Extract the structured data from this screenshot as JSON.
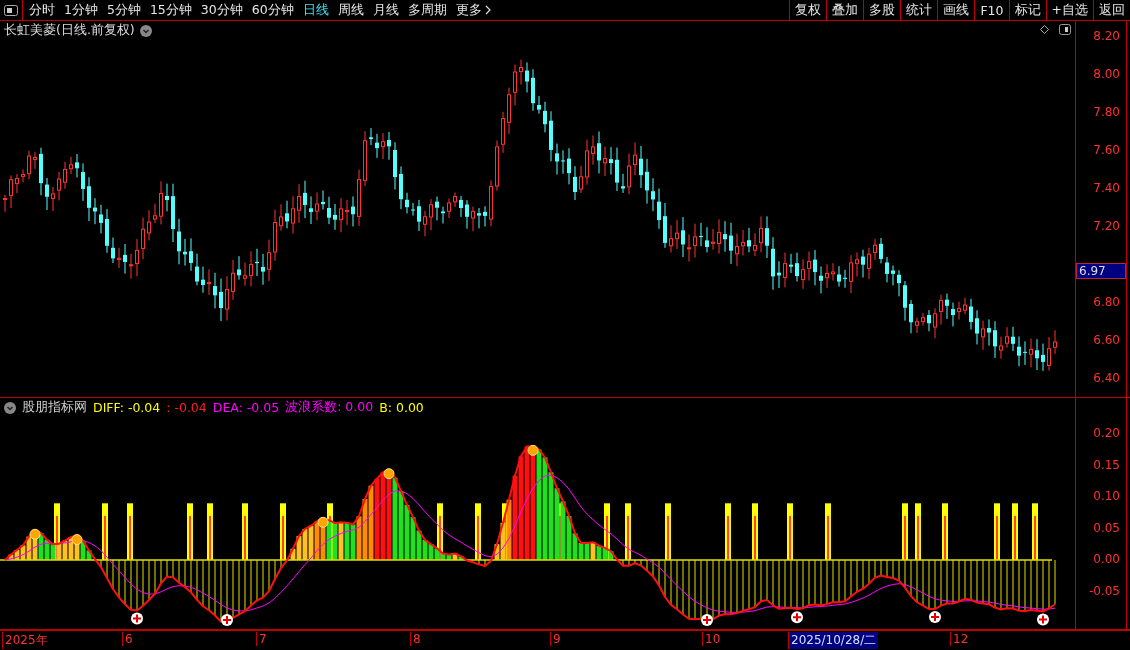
{
  "toolbar": {
    "periods": [
      {
        "label": "分时",
        "selected": false
      },
      {
        "label": "1分钟",
        "selected": false
      },
      {
        "label": "5分钟",
        "selected": false
      },
      {
        "label": "15分钟",
        "selected": false
      },
      {
        "label": "30分钟",
        "selected": false
      },
      {
        "label": "60分钟",
        "selected": false
      },
      {
        "label": "日线",
        "selected": true
      },
      {
        "label": "周线",
        "selected": false
      },
      {
        "label": "月线",
        "selected": false
      },
      {
        "label": "多周期",
        "selected": false
      },
      {
        "label": "更多",
        "selected": false
      }
    ],
    "buttons": [
      "复权",
      "叠加",
      "多股",
      "统计",
      "画线",
      "F10",
      "标记",
      "+自选",
      "返回"
    ]
  },
  "price_chart": {
    "title": "长虹美菱(日线.前复权)",
    "ticks": [
      "8.20",
      "8.00",
      "7.80",
      "7.60",
      "7.40",
      "7.20",
      "6.80",
      "6.60",
      "6.40"
    ],
    "current_price": "6.97"
  },
  "indicator": {
    "name": "股朋指标网",
    "readings": [
      {
        "text": "DIFF: -0.04",
        "color": "#ffff00"
      },
      {
        "text": ": -0.04",
        "color": "#ff2020"
      },
      {
        "text": "DEA: -0.05",
        "color": "#ff00ff"
      },
      {
        "text": "波浪系数: 0.00",
        "color": "#ff00ff"
      },
      {
        "text": "B: 0.00",
        "color": "#ffff00"
      }
    ],
    "ticks": [
      "0.20",
      "0.15",
      "0.10",
      "0.05",
      "0.00",
      "-0.05"
    ]
  },
  "time_axis": {
    "labels": [
      {
        "text": "2025年",
        "selected": false
      },
      {
        "text": "6",
        "selected": false
      },
      {
        "text": "7",
        "selected": false
      },
      {
        "text": "8",
        "selected": false
      },
      {
        "text": "9",
        "selected": false
      },
      {
        "text": "10",
        "selected": false
      },
      {
        "text": "2025/10/28/二",
        "selected": true
      },
      {
        "text": "12",
        "selected": false
      }
    ]
  }
}
